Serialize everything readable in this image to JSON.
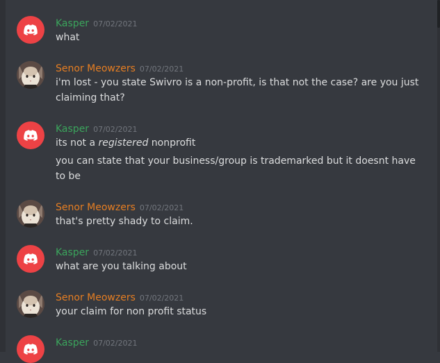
{
  "messages": [
    {
      "author": "Kasper",
      "timestamp": "07/02/2021",
      "avatar": "discord-logo-icon",
      "lines": [
        "what"
      ]
    },
    {
      "author": "Senor Meowzers",
      "timestamp": "07/02/2021",
      "avatar": "cat-avatar",
      "lines": [
        "i'm lost - you state Swivro is a non-profit, is that not the case? are you just claiming that?"
      ]
    },
    {
      "author": "Kasper",
      "timestamp": "07/02/2021",
      "avatar": "discord-logo-icon",
      "line1_before": "its not a ",
      "line1_emph": "registered",
      "line1_after": " nonprofit",
      "line2": "you can state that your business/group is trademarked but it doesnt have to be"
    },
    {
      "author": "Senor Meowzers",
      "timestamp": "07/02/2021",
      "avatar": "cat-avatar",
      "lines": [
        "that's pretty shady to claim."
      ]
    },
    {
      "author": "Kasper",
      "timestamp": "07/02/2021",
      "avatar": "discord-logo-icon",
      "lines": [
        "what are you talking about"
      ]
    },
    {
      "author": "Senor Meowzers",
      "timestamp": "07/02/2021",
      "avatar": "cat-avatar",
      "lines": [
        "your claim for non profit status"
      ]
    },
    {
      "author": "Kasper",
      "timestamp": "07/02/2021",
      "avatar": "discord-logo-icon",
      "lines": []
    }
  ],
  "colors": {
    "background": "#36393f",
    "kasper_name": "#3ba55c",
    "meowzers_name": "#e67e22",
    "message_text": "#dcddde",
    "timestamp": "#72767d",
    "discord_red": "#ed4245"
  }
}
